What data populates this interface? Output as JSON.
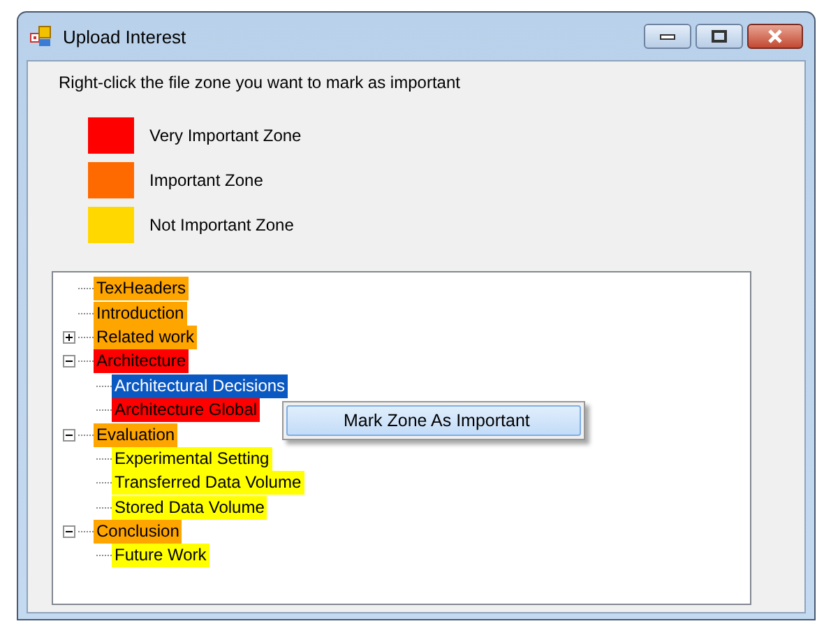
{
  "window": {
    "title": "Upload Interest"
  },
  "instruction": "Right-click the file zone you want to mark as important",
  "legend": [
    {
      "label": "Very Important Zone",
      "color": "#ff0000"
    },
    {
      "label": "Important Zone",
      "color": "#ff6a00"
    },
    {
      "label": "Not Important Zone",
      "color": "#ffd800"
    }
  ],
  "tree": [
    {
      "label": "TexHeaders",
      "color": "#ffa500",
      "selected": false
    },
    {
      "label": "Introduction",
      "color": "#ffa500",
      "selected": false
    },
    {
      "label": "Related work",
      "color": "#ffa500",
      "selected": false,
      "expanded": false
    },
    {
      "label": "Architecture",
      "color": "#ff0000",
      "selected": false,
      "expanded": true,
      "children": [
        {
          "label": "Architectural Decisions",
          "selected": true
        },
        {
          "label": "Architecture Global",
          "color": "#ff0000",
          "selected": false
        }
      ]
    },
    {
      "label": "Evaluation",
      "color": "#ffa500",
      "selected": false,
      "expanded": true,
      "children": [
        {
          "label": "Experimental Setting",
          "color": "#ffff00",
          "selected": false
        },
        {
          "label": "Transferred Data Volume",
          "color": "#ffff00",
          "selected": false
        },
        {
          "label": "Stored Data Volume",
          "color": "#ffff00",
          "selected": false
        }
      ]
    },
    {
      "label": "Conclusion",
      "color": "#ffa500",
      "selected": false,
      "expanded": true,
      "children": [
        {
          "label": "Future Work",
          "color": "#ffff00",
          "selected": false
        }
      ]
    }
  ],
  "context_menu": {
    "items": [
      "Mark Zone As Important"
    ]
  }
}
